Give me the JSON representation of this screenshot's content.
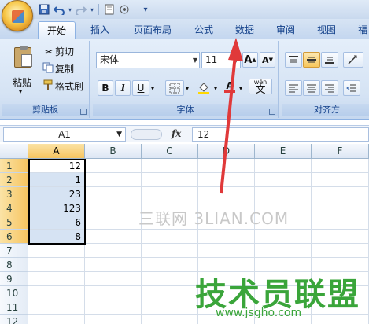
{
  "qat": {
    "icons": [
      "save-icon",
      "undo-icon",
      "redo-icon",
      "print-preview-icon",
      "record-icon"
    ]
  },
  "tabs": [
    "开始",
    "插入",
    "页面布局",
    "公式",
    "数据",
    "审阅",
    "视图",
    "福"
  ],
  "clipboard": {
    "paste_label": "粘贴",
    "cut_label": "剪切",
    "copy_label": "复制",
    "format_painter_label": "格式刷",
    "group_label": "剪贴板"
  },
  "font": {
    "name": "宋体",
    "size": "11",
    "bold": "B",
    "italic": "I",
    "underline": "U",
    "grow": "A",
    "shrink": "A",
    "color_a": "A",
    "wen": "wén",
    "wen_char": "文",
    "group_label": "字体"
  },
  "alignment": {
    "group_label": "对齐方"
  },
  "formula_bar": {
    "name_box": "A1",
    "fx": "fx",
    "value": "12"
  },
  "grid": {
    "columns": [
      "A",
      "B",
      "C",
      "D",
      "E",
      "F"
    ],
    "rows": [
      "1",
      "2",
      "3",
      "4",
      "5",
      "6",
      "7",
      "8",
      "9",
      "10",
      "11",
      "12"
    ],
    "a_values": [
      "12",
      "1",
      "23",
      "123",
      "6",
      "8"
    ]
  },
  "watermark": {
    "line1": "三联网 3LIAN.COM",
    "line2": "技术员联盟",
    "line3": "www.jsgho.com"
  },
  "colors": {
    "accent": "#15428b",
    "arrow": "#e0393a",
    "selection": "#f6c561"
  }
}
